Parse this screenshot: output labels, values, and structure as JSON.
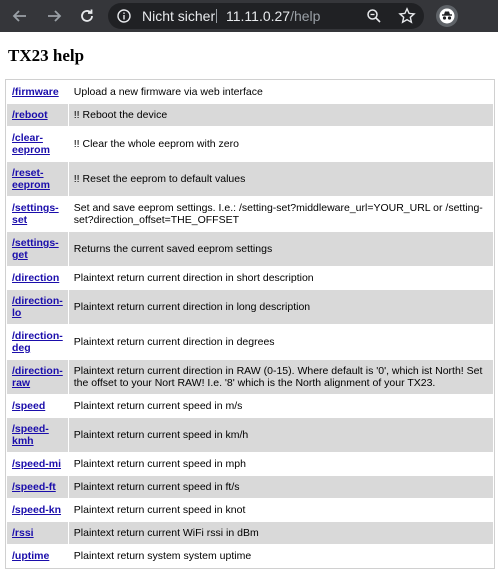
{
  "browser": {
    "security_label": "Nicht sicher",
    "url_host": "11.11.0.27",
    "url_path": "/help"
  },
  "page": {
    "title": "TX23 help"
  },
  "commands": [
    {
      "cmd": "/firmware",
      "desc": "Upload a new firmware via web interface"
    },
    {
      "cmd": "/reboot",
      "desc": "!! Reboot the device"
    },
    {
      "cmd": "/clear-eeprom",
      "desc": "!! Clear the whole eeprom with zero"
    },
    {
      "cmd": "/reset-eeprom",
      "desc": "!! Reset the eeprom to default values"
    },
    {
      "cmd": "/settings-set",
      "desc": "Set and save eeprom settings. I.e.: /setting-set?middleware_url=YOUR_URL or /setting-set?direction_offset=THE_OFFSET"
    },
    {
      "cmd": "/settings-get",
      "desc": "Returns the current saved eeprom settings"
    },
    {
      "cmd": "/direction",
      "desc": "Plaintext return current direction in short description"
    },
    {
      "cmd": "/direction-lo",
      "desc": "Plaintext return current direction in long description"
    },
    {
      "cmd": "/direction-deg",
      "desc": "Plaintext return current direction in degrees"
    },
    {
      "cmd": "/direction-raw",
      "desc": "Plaintext return current direction in RAW (0-15). Where default is '0', which ist North! Set the offset to your Nort RAW! I.e. '8' which is the North alignment of your TX23."
    },
    {
      "cmd": "/speed",
      "desc": "Plaintext return current speed in m/s"
    },
    {
      "cmd": "/speed-kmh",
      "desc": "Plaintext return current speed in km/h"
    },
    {
      "cmd": "/speed-mi",
      "desc": "Plaintext return current speed in mph"
    },
    {
      "cmd": "/speed-ft",
      "desc": "Plaintext return current speed in ft/s"
    },
    {
      "cmd": "/speed-kn",
      "desc": "Plaintext return current speed in knot"
    },
    {
      "cmd": "/rssi",
      "desc": "Plaintext return current WiFi rssi in dBm"
    },
    {
      "cmd": "/uptime",
      "desc": "Plaintext return system system uptime"
    }
  ]
}
